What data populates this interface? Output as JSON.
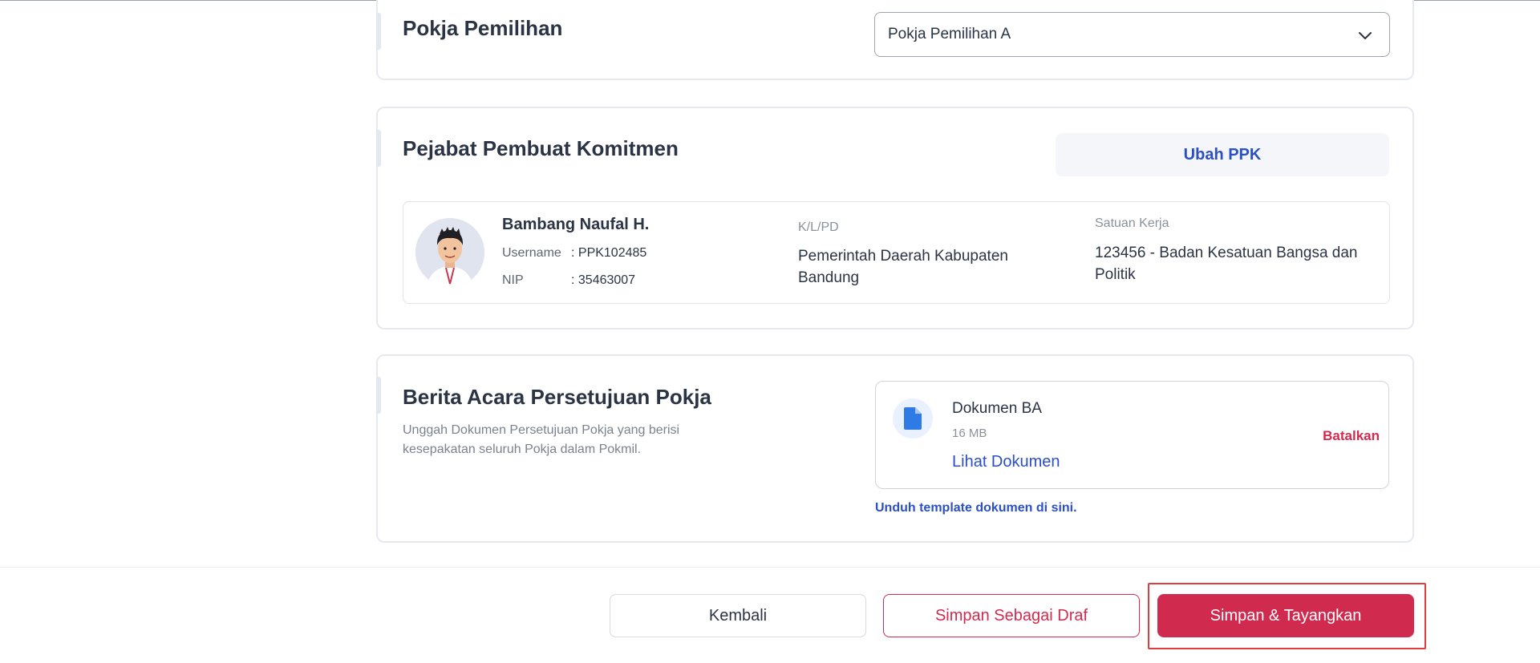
{
  "pokja": {
    "title": "Pokja Pemilihan",
    "select_value": "Pokja Pemilihan A"
  },
  "ppk": {
    "title": "Pejabat Pembuat Komitmen",
    "change_label": "Ubah PPK",
    "name": "Bambang Naufal H.",
    "username_label": "Username",
    "username_value": ": PPK102485",
    "nip_label": "NIP",
    "nip_value": ": 35463007",
    "kl_label": "K/L/PD",
    "kl_value": "Pemerintah Daerah Kabupaten Bandung",
    "satker_label": "Satuan Kerja",
    "satker_value": "123456 - Badan Kesatuan Bangsa dan Politik"
  },
  "ba": {
    "title": "Berita Acara Persetujuan Pokja",
    "description": "Unggah Dokumen Persetujuan Pokja yang berisi kesepakatan seluruh Pokja dalam Pokmil.",
    "doc_name": "Dokumen BA",
    "doc_size": "16 MB",
    "view_label": "Lihat Dokumen",
    "cancel_label": "Batalkan",
    "template_link": "Unduh template dokumen di sini."
  },
  "footer": {
    "back_label": "Kembali",
    "draft_label": "Simpan Sebagai Draf",
    "publish_label": "Simpan & Tayangkan"
  },
  "colors": {
    "primary_red": "#d12a4f",
    "link_blue": "#2b4fc4",
    "highlight": "#e03e3e"
  },
  "icons": {
    "select": "chevron-down-icon",
    "document": "file-icon",
    "avatar": "avatar"
  }
}
